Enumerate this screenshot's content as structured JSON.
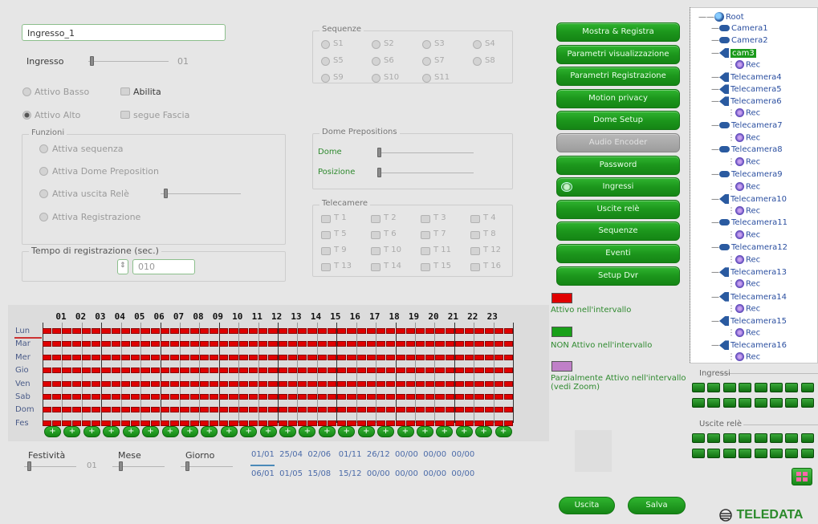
{
  "left_panel": {
    "name_value": "Ingresso_1",
    "ingresso_label": "Ingresso",
    "ingresso_value": "01",
    "attivo_basso": "Attivo Basso",
    "abilita": "Abilita",
    "attivo_alto": "Attivo Alto",
    "segue_fascia": "segue Fascia",
    "funzioni_title": "Funzioni",
    "funzioni": [
      "Attiva sequenza",
      "Attiva Dome Preposition",
      "Attiva uscita Relè",
      "Attiva Registrazione"
    ],
    "tempo_title": "Tempo di registrazione (sec.)",
    "tempo_value": "010"
  },
  "sequenze": {
    "title": "Sequenze",
    "items": [
      "S1",
      "S2",
      "S3",
      "S4",
      "S5",
      "S6",
      "S7",
      "S8",
      "S9",
      "S10",
      "S11"
    ]
  },
  "dome": {
    "title": "Dome Prepositions",
    "dome_label": "Dome",
    "posizione_label": "Posizione"
  },
  "telecamere": {
    "title": "Telecamere",
    "items": [
      "T 1",
      "T 2",
      "T 3",
      "T 4",
      "T 5",
      "T 6",
      "T 7",
      "T 8",
      "T 9",
      "T 10",
      "T 11",
      "T 12",
      "T 13",
      "T 14",
      "T 15",
      "T 16"
    ]
  },
  "buttons": [
    {
      "label": "Mostra & Registra",
      "disabled": false
    },
    {
      "label": "Parametri visualizzazione",
      "disabled": false
    },
    {
      "label": "Parametri Registrazione",
      "disabled": false
    },
    {
      "label": "Motion privacy",
      "disabled": false
    },
    {
      "label": "Dome Setup",
      "disabled": false
    },
    {
      "label": "Audio Encoder",
      "disabled": true
    },
    {
      "label": "Password",
      "disabled": false
    },
    {
      "label": "Ingressi",
      "disabled": false
    },
    {
      "label": "Uscite relè",
      "disabled": false
    },
    {
      "label": "Sequenze",
      "disabled": false
    },
    {
      "label": "Eventi",
      "disabled": false
    },
    {
      "label": "Setup Dvr",
      "disabled": false
    }
  ],
  "legend": {
    "attivo": "Attivo nell'intervallo",
    "non_attivo": "NON Attivo nell'intervallo",
    "parziale": "Parzialmente Attivo nell'intervallo (vedi Zoom)",
    "colors": {
      "attivo": "#e00000",
      "non_attivo": "#19a019",
      "parziale": "#c080c8"
    }
  },
  "schedule": {
    "hours": [
      "01",
      "02",
      "03",
      "04",
      "05",
      "06",
      "07",
      "08",
      "09",
      "10",
      "11",
      "12",
      "13",
      "14",
      "15",
      "16",
      "17",
      "18",
      "19",
      "20",
      "21",
      "22",
      "23"
    ],
    "days": [
      "Lun",
      "Mar",
      "Mer",
      "Gio",
      "Ven",
      "Sab",
      "Dom",
      "Fes"
    ],
    "plus_label": "+"
  },
  "festivita": {
    "festivita_label": "Festività",
    "festivita_value": "01",
    "mese_label": "Mese",
    "giorno_label": "Giorno",
    "row1": "01/01  25/04  02/06   01/11  26/12  00/00  00/00  00/00",
    "row2": "06/01  01/05  15/08   15/12  00/00  00/00  00/00  00/00"
  },
  "footer": {
    "uscita": "Uscita",
    "salva": "Salva",
    "brand": "TELEDATA"
  },
  "tree": {
    "root": "Root",
    "items": [
      {
        "label": "Camera1",
        "rec": false
      },
      {
        "label": "Camera2",
        "rec": false
      },
      {
        "label": "cam3",
        "rec": true,
        "selected": true
      },
      {
        "label": "Telecamera4",
        "rec": false
      },
      {
        "label": "Telecamera5",
        "rec": false
      },
      {
        "label": "Telecamera6",
        "rec": true
      },
      {
        "label": "Telecamera7",
        "rec": true
      },
      {
        "label": "Telecamera8",
        "rec": true
      },
      {
        "label": "Telecamera9",
        "rec": true
      },
      {
        "label": "Telecamera10",
        "rec": true
      },
      {
        "label": "Telecamera11",
        "rec": true
      },
      {
        "label": "Telecamera12",
        "rec": true
      },
      {
        "label": "Telecamera13",
        "rec": true
      },
      {
        "label": "Telecamera14",
        "rec": true
      },
      {
        "label": "Telecamera15",
        "rec": true
      },
      {
        "label": "Telecamera16",
        "rec": true
      }
    ],
    "rec_label": "Rec"
  },
  "io_panel": {
    "ingressi": "Ingressi",
    "uscite": "Uscite relè"
  }
}
